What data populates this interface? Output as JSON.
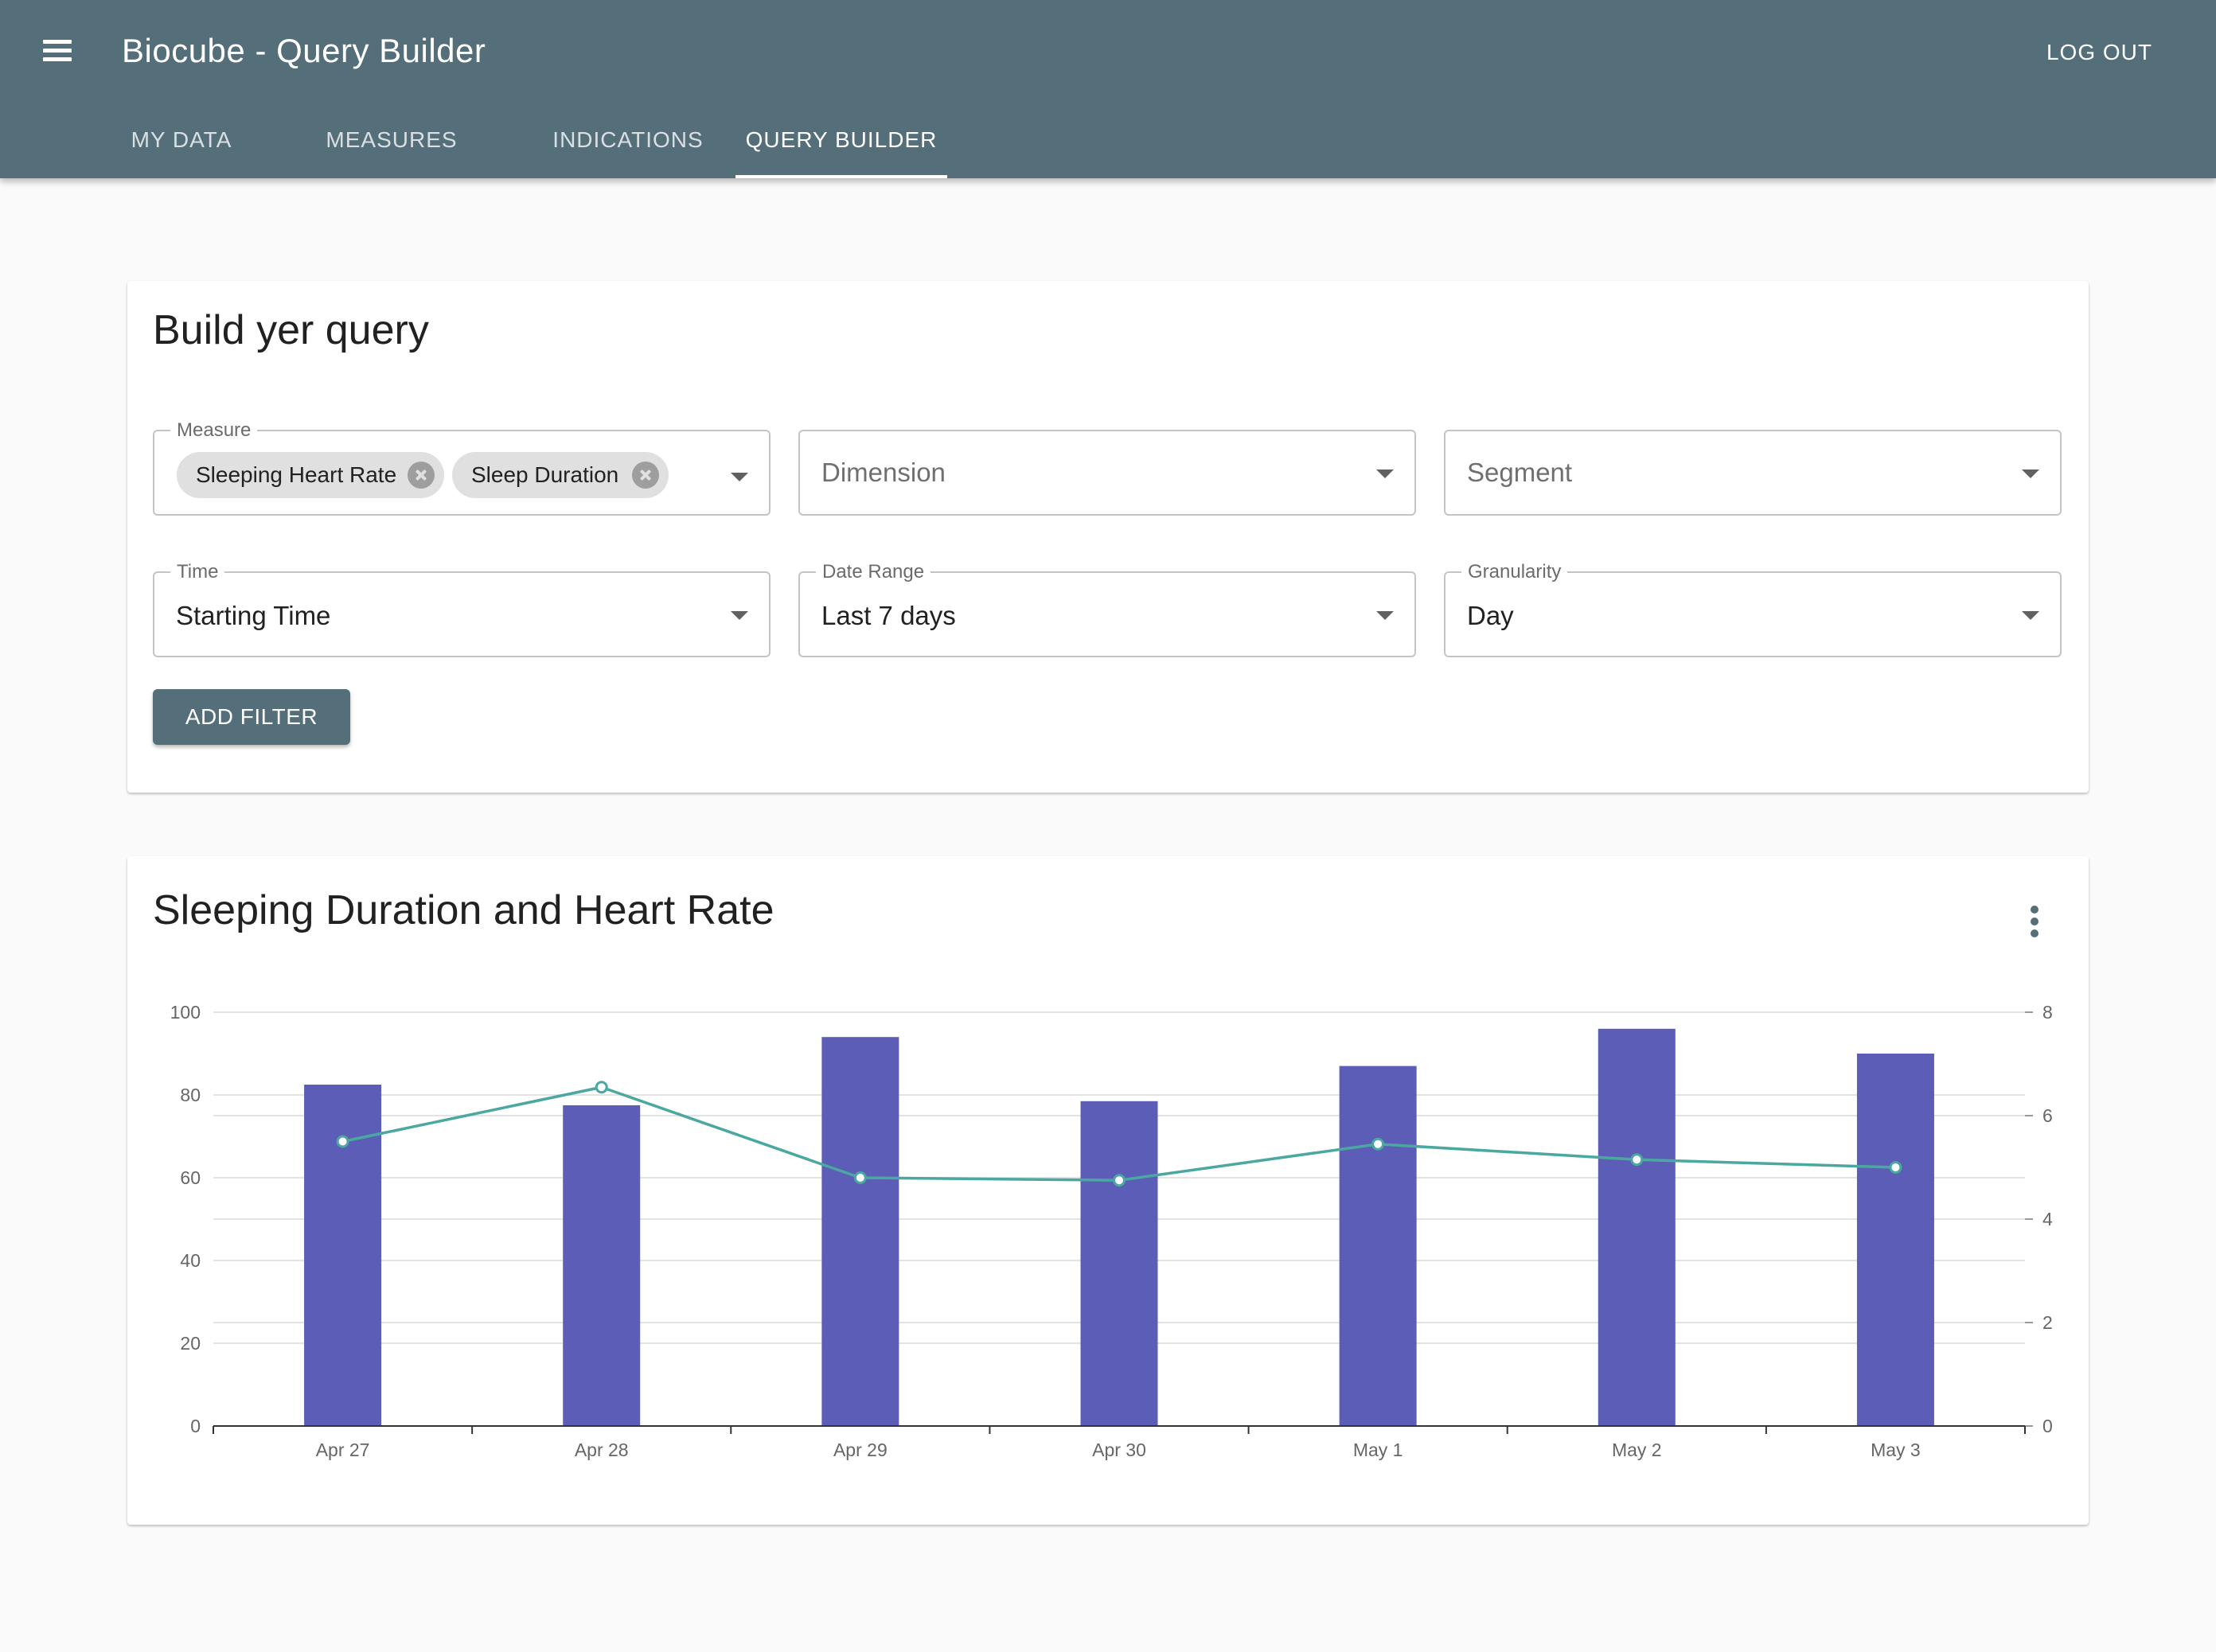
{
  "app": {
    "title": "Biocube - Query Builder",
    "logout_label": "LOG OUT",
    "tabs": [
      {
        "label": "MY DATA",
        "active": false
      },
      {
        "label": "MEASURES",
        "active": false
      },
      {
        "label": "INDICATIONS",
        "active": false
      },
      {
        "label": "QUERY BUILDER",
        "active": true
      }
    ],
    "menu_icon": "hamburger-menu-icon"
  },
  "query": {
    "title": "Build yer query",
    "measure": {
      "label": "Measure",
      "chips": [
        "Sleeping Heart Rate",
        "Sleep Duration"
      ]
    },
    "dimension": {
      "placeholder": "Dimension"
    },
    "segment": {
      "placeholder": "Segment"
    },
    "time": {
      "label": "Time",
      "value": "Starting Time"
    },
    "date_range": {
      "label": "Date Range",
      "value": "Last 7 days"
    },
    "granularity": {
      "label": "Granularity",
      "value": "Day"
    },
    "add_filter_label": "ADD FILTER"
  },
  "chart_card": {
    "title": "Sleeping Duration and Heart Rate",
    "more_icon": "more-vert-icon"
  },
  "chart_data": {
    "type": "bar",
    "categories": [
      "Apr 27",
      "Apr 28",
      "Apr 29",
      "Apr 30",
      "May 1",
      "May 2",
      "May 3"
    ],
    "series": [
      {
        "type": "bar",
        "axis": "left",
        "color": "#5c5db6",
        "values": [
          82.5,
          77.5,
          94,
          78.5,
          87,
          96,
          90
        ]
      },
      {
        "type": "line",
        "axis": "right",
        "color": "#4aa8a0",
        "values": [
          5.5,
          6.55,
          4.8,
          4.75,
          5.45,
          5.15,
          5.0
        ]
      }
    ],
    "y_left": {
      "ticks": [
        0,
        20,
        40,
        60,
        80,
        100
      ],
      "lim": [
        0,
        100
      ]
    },
    "y_right": {
      "ticks": [
        0,
        2,
        4,
        6,
        8
      ],
      "lim": [
        0,
        8
      ]
    },
    "grid": true,
    "legend": "none",
    "colors": {
      "axis": "#333333",
      "grid": "#e3e3e3",
      "tick_text": "#666666"
    }
  }
}
